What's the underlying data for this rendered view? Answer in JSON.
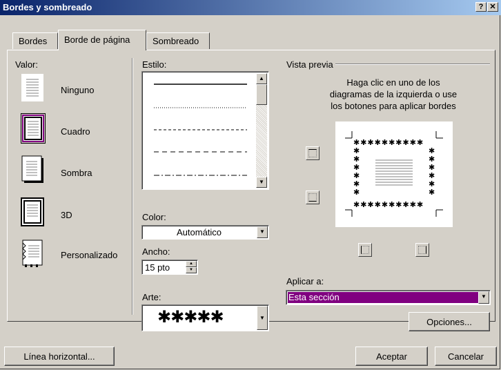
{
  "window": {
    "title": "Bordes y sombreado",
    "help_btn": "?",
    "close_btn": "✕"
  },
  "tabs": [
    {
      "label": "Bordes"
    },
    {
      "label": "Borde de página"
    },
    {
      "label": "Sombreado"
    }
  ],
  "valor": {
    "label": "Valor:",
    "options": [
      {
        "label": "Ninguno"
      },
      {
        "label": "Cuadro"
      },
      {
        "label": "Sombra"
      },
      {
        "label": "3D"
      },
      {
        "label": "Personalizado"
      }
    ]
  },
  "estilo": {
    "label": "Estilo:"
  },
  "color": {
    "label": "Color:",
    "value": "Automático"
  },
  "ancho": {
    "label": "Ancho:",
    "value": "15 pto"
  },
  "arte": {
    "label": "Arte:",
    "value": "✱✱✱✱✱"
  },
  "preview": {
    "label": "Vista previa",
    "instructions": [
      "Haga clic en uno de los",
      "diagramas de la izquierda o use",
      "los botones para aplicar bordes"
    ]
  },
  "aplicar": {
    "label": "Aplicar a:",
    "value": "Esta sección"
  },
  "buttons": {
    "opciones": "Opciones...",
    "linea_horizontal": "Línea horizontal...",
    "aceptar": "Aceptar",
    "cancelar": "Cancelar"
  },
  "colors": {
    "selection": "#800080",
    "title_start": "#0a246a",
    "title_end": "#a6caf0"
  }
}
